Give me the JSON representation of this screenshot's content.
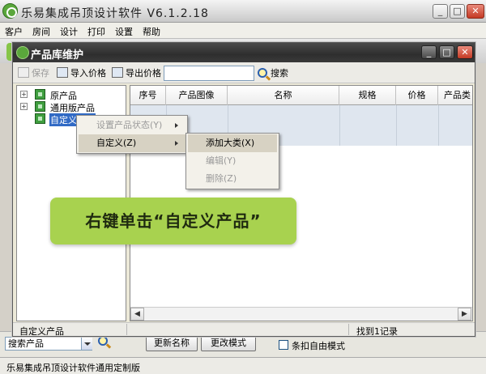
{
  "app": {
    "title": "乐易集成吊顶设计软件 V6.1.2.18",
    "menu": [
      "客户",
      "房间",
      "设计",
      "打印",
      "设置",
      "帮助"
    ],
    "status_text": "乐易集成吊顶设计软件通用定制版",
    "bottom": {
      "search_value": "搜索产品",
      "rename_button": "更新名称",
      "change_mode_button": "更改模式",
      "free_mode_checkbox": "条扣自由模式"
    }
  },
  "dialog": {
    "title": "产品库维护",
    "toolbar": {
      "save": "保存",
      "import_price": "导入价格",
      "export_price": "导出价格",
      "search_value": "",
      "search_button": "搜索"
    },
    "tree": [
      {
        "label": "原产品",
        "expandable": true
      },
      {
        "label": "通用版产品",
        "expandable": true
      },
      {
        "label": "自定义产品",
        "expandable": false,
        "selected": true
      }
    ],
    "grid": {
      "columns": [
        "序号",
        "产品图像",
        "名称",
        "规格",
        "价格",
        "产品类"
      ]
    },
    "status": {
      "left": "自定义产品",
      "right": "找到1记录"
    }
  },
  "context_menu": {
    "items": [
      {
        "label": "设置产品状态(Y)",
        "enabled": false,
        "submenu": true
      },
      {
        "label": "自定义(Z)",
        "enabled": true,
        "submenu": true,
        "highlighted": true
      }
    ],
    "submenu": [
      {
        "label": "添加大类(X)",
        "enabled": true,
        "highlighted": true
      },
      {
        "label": "编辑(Y)",
        "enabled": false
      },
      {
        "label": "删除(Z)",
        "enabled": false
      }
    ]
  },
  "callout": {
    "text": "右键单击“自定义产品”"
  },
  "colors": {
    "callout_bg": "#a8d24f",
    "dialog_title_bg": "#3a3a3a",
    "selection": "#316ac5"
  }
}
